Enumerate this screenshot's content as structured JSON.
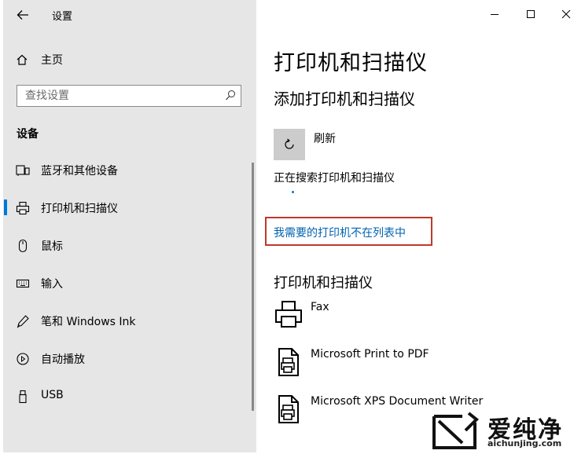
{
  "window": {
    "title": "设置",
    "minimize_glyph": "—",
    "maximize_glyph": "☐",
    "close_glyph": "✕"
  },
  "sidebar": {
    "home_label": "主页",
    "search_placeholder": "查找设置",
    "section_title": "设备",
    "items": [
      {
        "label": "蓝牙和其他设备",
        "icon": "bluetooth-devices-icon"
      },
      {
        "label": "打印机和扫描仪",
        "icon": "printer-icon",
        "selected": true
      },
      {
        "label": "鼠标",
        "icon": "mouse-icon"
      },
      {
        "label": "输入",
        "icon": "keyboard-icon"
      },
      {
        "label": "笔和 Windows Ink",
        "icon": "pen-icon"
      },
      {
        "label": "自动播放",
        "icon": "autoplay-icon"
      },
      {
        "label": "USB",
        "icon": "usb-icon"
      }
    ]
  },
  "main": {
    "title": "打印机和扫描仪",
    "add_section_title": "添加打印机和扫描仪",
    "refresh_label": "刷新",
    "searching_text": "正在搜索打印机和扫描仪",
    "not_listed_link": "我需要的打印机不在列表中",
    "list_title": "打印机和扫描仪",
    "printers": [
      {
        "name": "Fax",
        "icon": "fax-icon"
      },
      {
        "name": "Microsoft Print to PDF",
        "icon": "document-printer-icon"
      },
      {
        "name": "Microsoft XPS Document Writer",
        "icon": "document-printer-icon"
      }
    ]
  },
  "watermark": {
    "name": "爱纯净",
    "url": "aichunjing.com"
  },
  "colors": {
    "accent": "#0078d7",
    "link": "#0063b1",
    "highlight_box": "#c0392b",
    "sidebar_bg": "#e6e6e6"
  }
}
